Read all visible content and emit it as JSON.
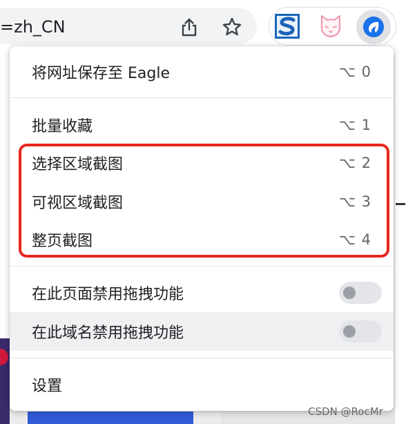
{
  "browser": {
    "url_fragment": "=zh_CN",
    "icons": {
      "share": "share-icon",
      "bookmark": "star-icon",
      "ext1": "s-extension-icon",
      "ext2": "cat-extension-icon",
      "ext3": "eagle-extension-icon"
    }
  },
  "menu": {
    "save_url": {
      "label": "将网址保存至 Eagle",
      "shortcut": "⌥ 0"
    },
    "batch_collect": {
      "label": "批量收藏",
      "shortcut": "⌥ 1"
    },
    "select_area": {
      "label": "选择区域截图",
      "shortcut": "⌥ 2"
    },
    "visible_area": {
      "label": "可视区域截图",
      "shortcut": "⌥ 3"
    },
    "full_page": {
      "label": "整页截图",
      "shortcut": "⌥ 4"
    },
    "disable_drag_page": {
      "label": "在此页面禁用拖拽功能",
      "enabled": false
    },
    "disable_drag_domain": {
      "label": "在此域名禁用拖拽功能",
      "enabled": false
    },
    "settings": {
      "label": "设置"
    }
  },
  "watermark": "CSDN @RocMr",
  "colors": {
    "highlight": "#e8271d",
    "menu_bg": "#ffffff",
    "hover_bg": "#eef0f2"
  }
}
